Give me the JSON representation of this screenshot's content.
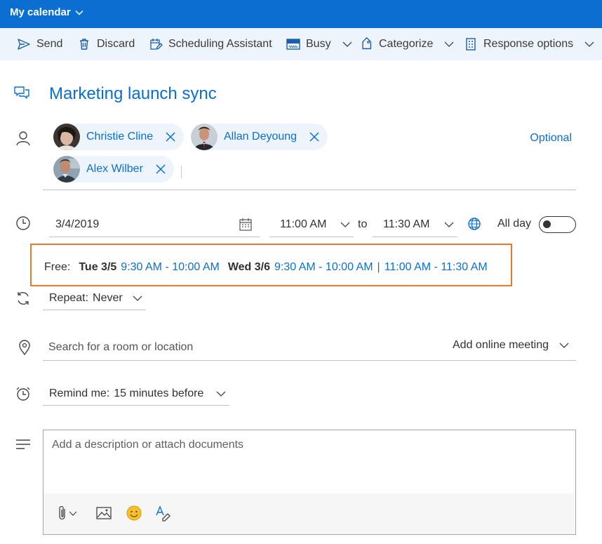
{
  "header": {
    "calendar_label": "My calendar"
  },
  "toolbar": {
    "send": "Send",
    "discard": "Discard",
    "scheduling": "Scheduling Assistant",
    "busy": "Busy",
    "categorize": "Categorize",
    "response": "Response options"
  },
  "event": {
    "title": "Marketing launch sync"
  },
  "attendees": [
    {
      "name": "Christie Cline"
    },
    {
      "name": "Allan Deyoung"
    },
    {
      "name": "Alex Wilber"
    }
  ],
  "optional_label": "Optional",
  "schedule": {
    "date": "3/4/2019",
    "start_time": "11:00 AM",
    "to_label": "to",
    "end_time": "11:30 AM",
    "all_day_label": "All day",
    "all_day_on": false
  },
  "free": {
    "label": "Free:",
    "days": [
      {
        "day": "Tue 3/5",
        "slots": [
          "9:30 AM - 10:00 AM"
        ]
      },
      {
        "day": "Wed 3/6",
        "slots": [
          "9:30 AM - 10:00 AM",
          "11:00 AM - 11:30 AM"
        ]
      }
    ],
    "separator": "|"
  },
  "repeat": {
    "label": "Repeat:",
    "value": "Never"
  },
  "location": {
    "placeholder": "Search for a room or location",
    "online_meeting": "Add online meeting"
  },
  "reminder": {
    "label": "Remind me:",
    "value": "15 minutes before"
  },
  "description": {
    "placeholder": "Add a description or attach documents"
  },
  "colors": {
    "accent": "#0a6fd1",
    "highlight_border": "#e8792e",
    "toolbar_bg": "#eef4fb"
  }
}
